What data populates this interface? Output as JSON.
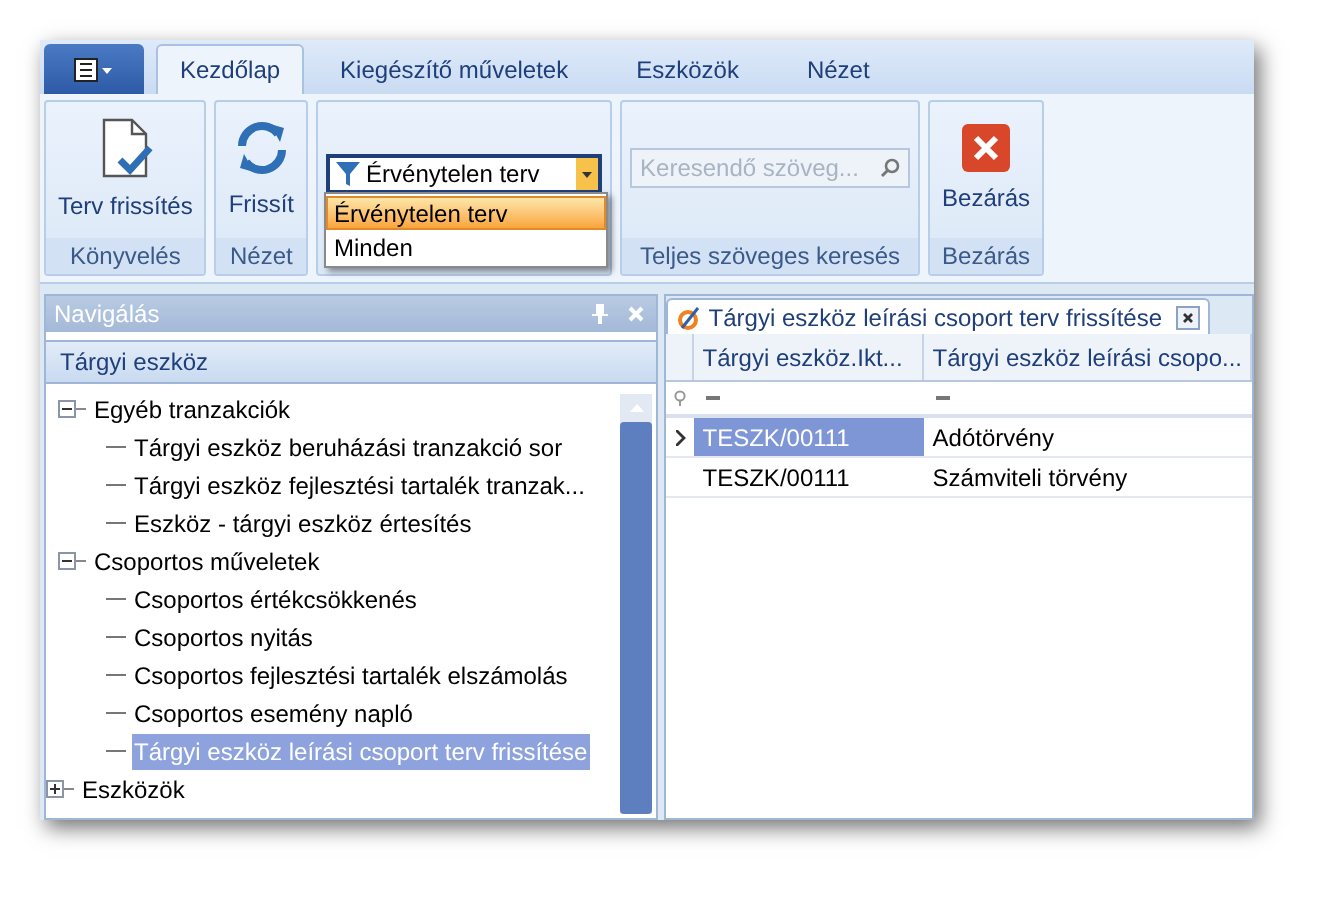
{
  "ribbon": {
    "tabs": [
      {
        "label": "Kezdőlap",
        "selected": true
      },
      {
        "label": "Kiegészítő műveletek",
        "selected": false
      },
      {
        "label": "Eszközök",
        "selected": false
      },
      {
        "label": "Nézet",
        "selected": false
      }
    ],
    "groups": [
      {
        "kind": "buttons",
        "label": "Könyvelés",
        "buttons": [
          {
            "label": "Terv frissítés"
          }
        ]
      },
      {
        "kind": "buttons",
        "label": "Nézet",
        "buttons": [
          {
            "label": "Frissít"
          }
        ]
      },
      {
        "kind": "dropdown",
        "value": "Érvénytelen terv",
        "options": [
          {
            "label": "Érvénytelen terv",
            "selected": true
          },
          {
            "label": "Minden",
            "selected": false
          }
        ]
      },
      {
        "kind": "search",
        "label": "Teljes szöveges keresés",
        "placeholder": "Keresendő szöveg..."
      },
      {
        "kind": "buttons",
        "label": "Bezárás",
        "buttons": [
          {
            "label": "Bezárás"
          }
        ]
      }
    ]
  },
  "navigation": {
    "title": "Navigálás",
    "section": "Tárgyi eszköz",
    "tree": [
      {
        "children": [
          {
            "label": "Egyéb tranzakciók",
            "expanded": true,
            "children": [
              {
                "label": "Tárgyi eszköz beruházási tranzakció sor",
                "selected": false
              },
              {
                "label": "Tárgyi eszköz fejlesztési tartalék tranzak...",
                "selected": false
              },
              {
                "label": "Eszköz - tárgyi eszköz értesítés",
                "selected": false
              }
            ]
          },
          {
            "label": "Csoportos műveletek",
            "expanded": true,
            "children": [
              {
                "label": "Csoportos értékcsökkenés",
                "selected": false
              },
              {
                "label": "Csoportos nyitás",
                "selected": false
              },
              {
                "label": "Csoportos fejlesztési tartalék elszámolás",
                "selected": false
              },
              {
                "label": "Csoportos esemény napló",
                "selected": false
              },
              {
                "label": "Tárgyi eszköz leírási csoport terv frissítése",
                "selected": true
              }
            ]
          }
        ]
      },
      {
        "label": "Eszközök",
        "expanded": false
      }
    ]
  },
  "document": {
    "tab": "Tárgyi eszköz leírási csoport terv frissítése",
    "table": {
      "columns": [
        "Tárgyi eszköz.Ikt...",
        "Tárgyi eszköz leírási csopo..."
      ],
      "rows": [
        {
          "cells": [
            "TESZK/00111",
            "Adótörvény"
          ],
          "selected": true
        },
        {
          "cells": [
            "TESZK/00111",
            "Számviteli törvény"
          ],
          "selected": false
        }
      ]
    }
  }
}
